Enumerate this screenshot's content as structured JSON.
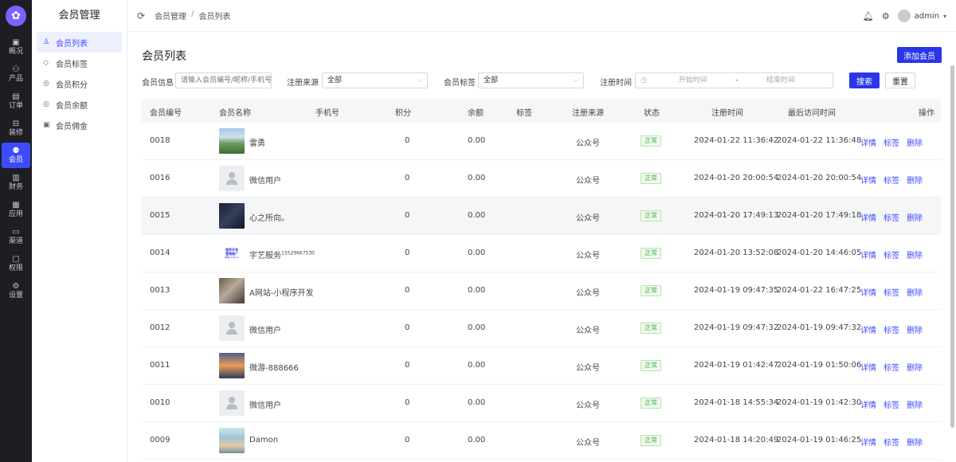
{
  "rail": {
    "items": [
      {
        "label": "概况",
        "icon": "▣",
        "name": "overview"
      },
      {
        "label": "产品",
        "icon": "⚇",
        "name": "product"
      },
      {
        "label": "订单",
        "icon": "▤",
        "name": "order"
      },
      {
        "label": "装修",
        "icon": "⊟",
        "name": "decoration"
      },
      {
        "label": "会员",
        "icon": "⚉",
        "name": "member"
      },
      {
        "label": "财务",
        "icon": "▥",
        "name": "finance"
      },
      {
        "label": "应用",
        "icon": "▦",
        "name": "application"
      },
      {
        "label": "渠道",
        "icon": "▭",
        "name": "channel"
      },
      {
        "label": "权限",
        "icon": "▢",
        "name": "permission"
      },
      {
        "label": "设置",
        "icon": "⚙",
        "name": "settings"
      }
    ],
    "active": "member",
    "accent": "#3d4bff"
  },
  "submenu": {
    "title": "会员管理",
    "items": [
      {
        "label": "会员列表",
        "icon": "♙"
      },
      {
        "label": "会员标签",
        "icon": "◇"
      },
      {
        "label": "会员积分",
        "icon": "◎"
      },
      {
        "label": "会员余额",
        "icon": "◎"
      },
      {
        "label": "会员佣金",
        "icon": "▣"
      }
    ]
  },
  "header": {
    "breadcrumb": [
      "会员管理",
      "会员列表"
    ],
    "separator": "/",
    "user": "admin"
  },
  "page": {
    "title": "会员列表",
    "add_button": "添加会员"
  },
  "filters": {
    "info_label": "会员信息",
    "info_placeholder": "请输入会员编号/昵称/手机号",
    "source_label": "注册来源",
    "source_value": "全部",
    "tag_label": "会员标签",
    "tag_value": "全部",
    "time_label": "注册时间",
    "start_placeholder": "开始时间",
    "end_placeholder": "结束时间",
    "date_sep": "-",
    "search_button": "搜索",
    "reset_button": "重置"
  },
  "table": {
    "columns": [
      "会员编号",
      "会员名称",
      "手机号",
      "积分",
      "余额",
      "标签",
      "注册来源",
      "状态",
      "注册时间",
      "最后访问时间",
      "操作"
    ],
    "actions": [
      "详情",
      "标签",
      "删除"
    ],
    "rows": [
      {
        "id": "0018",
        "name": "雷勇",
        "phone": "",
        "points": "0",
        "balance": "0.00",
        "tag": "",
        "source": "公众号",
        "status": "正常",
        "reg_time": "2024-01-22 11:36:42",
        "last_visit": "2024-01-22 11:36:48",
        "avatar": "mountain"
      },
      {
        "id": "0016",
        "name": "微信用户",
        "phone": "",
        "points": "0",
        "balance": "0.00",
        "tag": "",
        "source": "公众号",
        "status": "正常",
        "reg_time": "2024-01-20 20:00:54",
        "last_visit": "2024-01-20 20:00:54",
        "avatar": "default"
      },
      {
        "id": "0015",
        "name": "心之所向。",
        "phone": "",
        "points": "0",
        "balance": "0.00",
        "tag": "",
        "source": "公众号",
        "status": "正常",
        "reg_time": "2024-01-20 17:49:13",
        "last_visit": "2024-01-20 17:49:18",
        "avatar": "dark"
      },
      {
        "id": "0014",
        "name": "宇艺服务",
        "name_suffix": "15529667530",
        "phone": "",
        "points": "0",
        "balance": "0.00",
        "tag": "",
        "source": "公众号",
        "status": "正常",
        "reg_time": "2024-01-20 13:52:08",
        "last_visit": "2024-01-20 14:46:05",
        "avatar": "text",
        "avatar_text": [
          "程序开发",
          "营销推广",
          "微信y10kum"
        ]
      },
      {
        "id": "0013",
        "name": "A网站-小程序开发",
        "phone": "",
        "points": "0",
        "balance": "0.00",
        "tag": "",
        "source": "公众号",
        "status": "正常",
        "reg_time": "2024-01-19 09:47:35",
        "last_visit": "2024-01-22 16:47:25",
        "avatar": "photo"
      },
      {
        "id": "0012",
        "name": "微信用户",
        "phone": "",
        "points": "0",
        "balance": "0.00",
        "tag": "",
        "source": "公众号",
        "status": "正常",
        "reg_time": "2024-01-19 09:47:32",
        "last_visit": "2024-01-19 09:47:32",
        "avatar": "default"
      },
      {
        "id": "0011",
        "name": "微游-888666",
        "phone": "",
        "points": "0",
        "balance": "0.00",
        "tag": "",
        "source": "公众号",
        "status": "正常",
        "reg_time": "2024-01-19 01:42:47",
        "last_visit": "2024-01-19 01:50:06",
        "avatar": "sunset"
      },
      {
        "id": "0010",
        "name": "微信用户",
        "phone": "",
        "points": "0",
        "balance": "0.00",
        "tag": "",
        "source": "公众号",
        "status": "正常",
        "reg_time": "2024-01-18 14:55:34",
        "last_visit": "2024-01-19 01:42:30",
        "avatar": "default"
      },
      {
        "id": "0009",
        "name": "Damon",
        "phone": "",
        "points": "0",
        "balance": "0.00",
        "tag": "",
        "source": "公众号",
        "status": "正常",
        "reg_time": "2024-01-18 14:20:49",
        "last_visit": "2024-01-19 01:46:25",
        "avatar": "portrait"
      }
    ]
  }
}
